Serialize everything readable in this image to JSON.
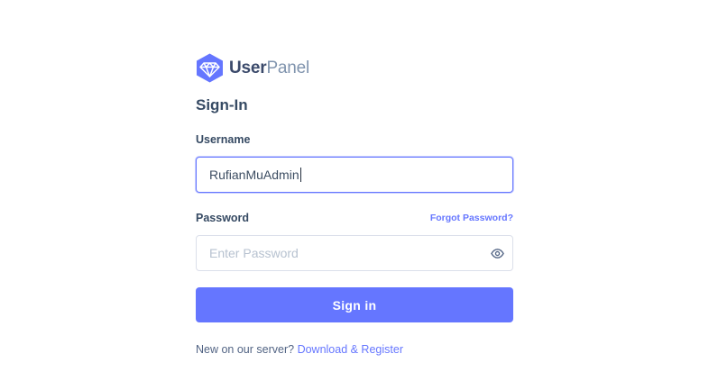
{
  "brand": {
    "name_strong": "User",
    "name_light": "Panel",
    "logo_icon": "gem-icon",
    "accent_color": "#6576ff"
  },
  "form": {
    "title": "Sign-In",
    "username": {
      "label": "Username",
      "value": "RufianMuAdmin"
    },
    "password": {
      "label": "Password",
      "placeholder": "Enter Password",
      "forgot_label": "Forgot Password?",
      "toggle_icon": "eye-icon"
    },
    "submit_label": "Sign in"
  },
  "footer": {
    "prompt": "New on our server?",
    "register_link": "Download & Register"
  }
}
